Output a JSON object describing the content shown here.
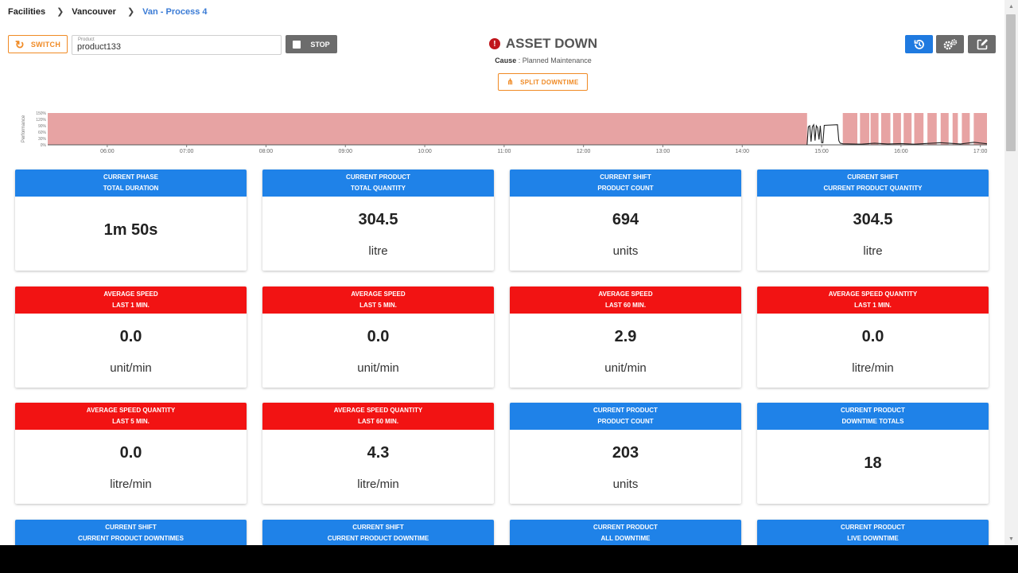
{
  "breadcrumb": [
    "Facilities",
    "Vancouver",
    "Van - Process 4"
  ],
  "toolbar": {
    "switch_label": "SWITCH",
    "product_label": "Product",
    "product_value": "product133",
    "stop_label": "STOP"
  },
  "status": {
    "title": "ASSET DOWN",
    "cause_label": "Cause",
    "cause_value": "Planned Maintenance",
    "split_label": "SPLIT DOWNTIME"
  },
  "actions": {
    "icons": [
      "history-icon",
      "settings-icon",
      "edit-icon"
    ]
  },
  "colors": {
    "blue": "#1f82e8",
    "red": "#f21313",
    "orange": "#f08a24",
    "timeline_fill": "#e7a3a3"
  },
  "chart_data": {
    "type": "area",
    "ylabel": "Performance",
    "yticks": [
      "150%",
      "120%",
      "90%",
      "60%",
      "30%",
      "0%"
    ],
    "xticks": [
      "06:00",
      "07:00",
      "08:00",
      "09:00",
      "10:00",
      "11:00",
      "12:00",
      "13:00",
      "14:00",
      "15:00",
      "16:00",
      "17:00"
    ],
    "x_range": [
      "05:15",
      "17:05"
    ],
    "downtime_fill": "#e7a3a3",
    "downtime_intervals": [
      [
        "05:15",
        "14:49"
      ],
      [
        "15:16",
        "15:27"
      ],
      [
        "15:29",
        "15:36"
      ],
      [
        "15:37",
        "15:43"
      ],
      [
        "15:45",
        "15:52"
      ],
      [
        "15:54",
        "16:00"
      ],
      [
        "16:02",
        "16:08"
      ],
      [
        "16:10",
        "16:17"
      ],
      [
        "16:20",
        "16:27"
      ],
      [
        "16:30",
        "16:36"
      ],
      [
        "16:39",
        "16:43"
      ],
      [
        "16:46",
        "16:52"
      ],
      [
        "16:55",
        "17:05"
      ]
    ],
    "performance": [
      [
        "14:49",
        0
      ],
      [
        "14:50",
        85
      ],
      [
        "14:51",
        90
      ],
      [
        "14:52",
        15
      ],
      [
        "14:53",
        85
      ],
      [
        "14:54",
        95
      ],
      [
        "14:55",
        20
      ],
      [
        "14:56",
        90
      ],
      [
        "14:57",
        80
      ],
      [
        "14:58",
        25
      ],
      [
        "14:59",
        90
      ],
      [
        "15:00",
        10
      ],
      [
        "15:01",
        10
      ],
      [
        "15:02",
        92
      ],
      [
        "15:12",
        95
      ],
      [
        "15:13",
        20
      ],
      [
        "15:14",
        8
      ],
      [
        "15:16",
        5
      ],
      [
        "15:30",
        3
      ],
      [
        "15:40",
        8
      ],
      [
        "15:50",
        4
      ],
      [
        "16:00",
        6
      ],
      [
        "16:10",
        3
      ],
      [
        "16:30",
        10
      ],
      [
        "16:45",
        4
      ],
      [
        "16:55",
        12
      ],
      [
        "17:05",
        5
      ]
    ]
  },
  "cards": [
    {
      "title1": "CURRENT PHASE",
      "title2": "TOTAL DURATION",
      "value": "1m 50s",
      "unit": "",
      "color": "blue"
    },
    {
      "title1": "CURRENT PRODUCT",
      "title2": "TOTAL QUANTITY",
      "value": "304.5",
      "unit": "litre",
      "color": "blue"
    },
    {
      "title1": "CURRENT SHIFT",
      "title2": "PRODUCT COUNT",
      "value": "694",
      "unit": "units",
      "color": "blue"
    },
    {
      "title1": "CURRENT SHIFT",
      "title2": "CURRENT PRODUCT QUANTITY",
      "value": "304.5",
      "unit": "litre",
      "color": "blue"
    },
    {
      "title1": "AVERAGE SPEED",
      "title2": "LAST 1 MIN.",
      "value": "0.0",
      "unit": "unit/min",
      "color": "red"
    },
    {
      "title1": "AVERAGE SPEED",
      "title2": "LAST 5 MIN.",
      "value": "0.0",
      "unit": "unit/min",
      "color": "red"
    },
    {
      "title1": "AVERAGE SPEED",
      "title2": "LAST 60 MIN.",
      "value": "2.9",
      "unit": "unit/min",
      "color": "red"
    },
    {
      "title1": "AVERAGE SPEED QUANTITY",
      "title2": "LAST 1 MIN.",
      "value": "0.0",
      "unit": "litre/min",
      "color": "red"
    },
    {
      "title1": "AVERAGE SPEED QUANTITY",
      "title2": "LAST 5 MIN.",
      "value": "0.0",
      "unit": "litre/min",
      "color": "red"
    },
    {
      "title1": "AVERAGE SPEED QUANTITY",
      "title2": "LAST 60 MIN.",
      "value": "4.3",
      "unit": "litre/min",
      "color": "red"
    },
    {
      "title1": "CURRENT PRODUCT",
      "title2": "PRODUCT COUNT",
      "value": "203",
      "unit": "units",
      "color": "blue"
    },
    {
      "title1": "CURRENT PRODUCT",
      "title2": "DOWNTIME TOTALS",
      "value": "18",
      "unit": "",
      "color": "blue"
    },
    {
      "title1": "CURRENT SHIFT",
      "title2": "CURRENT PRODUCT DOWNTIMES",
      "value": "",
      "unit": "",
      "color": "blue"
    },
    {
      "title1": "CURRENT SHIFT",
      "title2": "CURRENT PRODUCT DOWNTIME",
      "value": "",
      "unit": "",
      "color": "blue"
    },
    {
      "title1": "CURRENT PRODUCT",
      "title2": "ALL DOWNTIME",
      "value": "",
      "unit": "",
      "color": "blue"
    },
    {
      "title1": "CURRENT PRODUCT",
      "title2": "LIVE DOWNTIME",
      "value": "",
      "unit": "",
      "color": "blue"
    }
  ]
}
